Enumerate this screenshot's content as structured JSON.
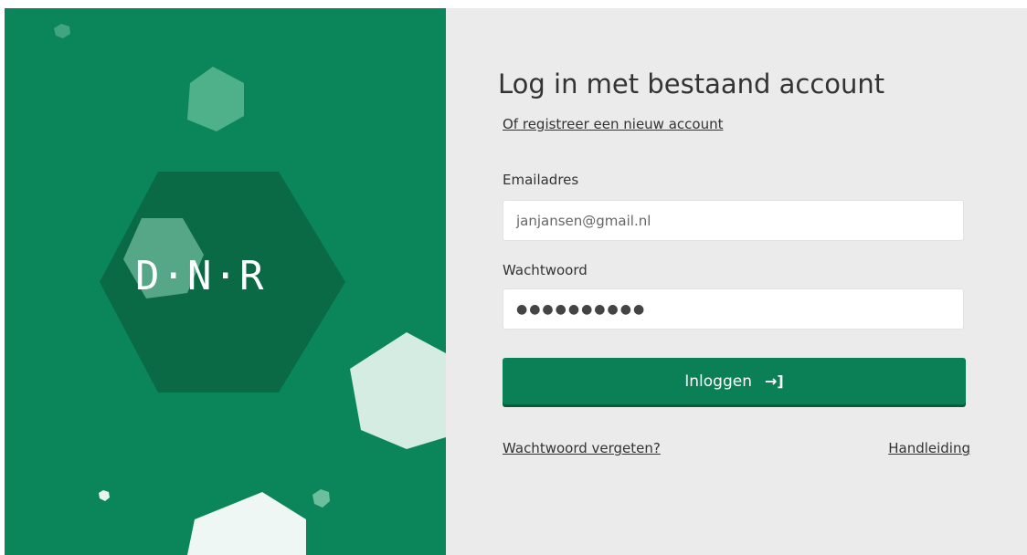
{
  "brand": {
    "logo_text": "D·N·R",
    "colors": {
      "panel": "#0b865b",
      "hex_dark": "#0a6a46"
    }
  },
  "form": {
    "title": "Log in met bestaand account",
    "register_link": "Of registreer een nieuw account",
    "email": {
      "label": "Emailadres",
      "value": "janjansen@gmail.nl"
    },
    "password": {
      "label": "Wachtwoord",
      "value": "●●●●●●●●●●"
    },
    "login_button": {
      "label": "Inloggen",
      "icon": "login-arrow-icon"
    },
    "forgot_link": "Wachtwoord vergeten?",
    "manual_link": "Handleiding",
    "colors": {
      "button": "#0b7f56",
      "background": "#ebebeb"
    }
  }
}
